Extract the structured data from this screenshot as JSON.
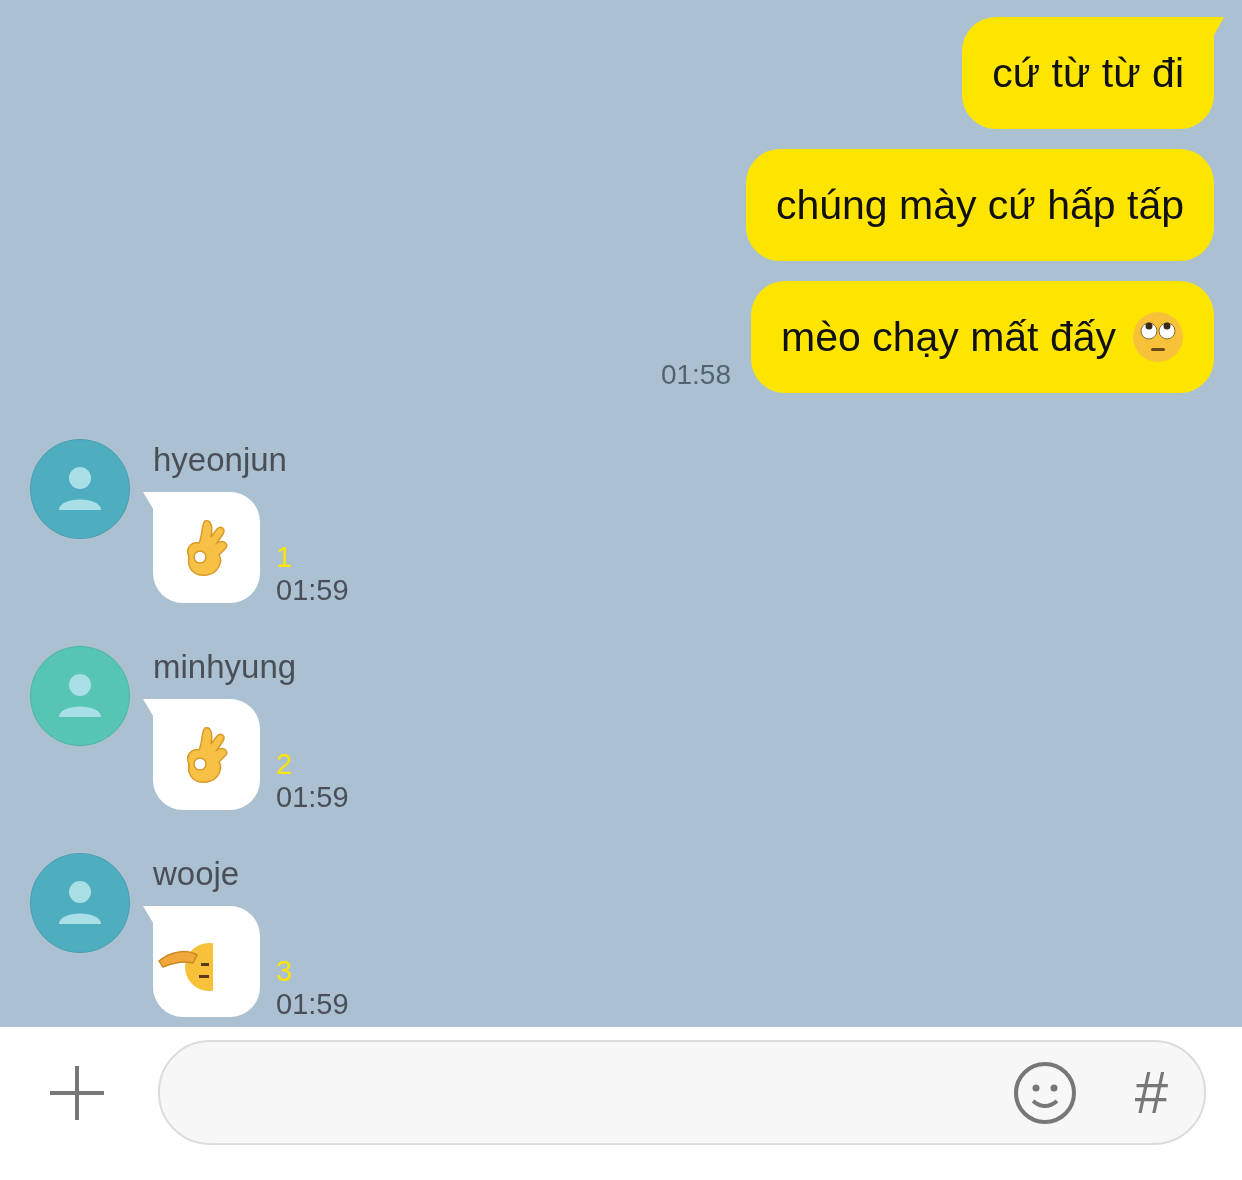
{
  "outgoing": [
    {
      "kind": "text",
      "text": "cứ từ từ đi",
      "tail": true
    },
    {
      "kind": "text",
      "text": "chúng mày cứ hấp tấp",
      "tail": false
    },
    {
      "kind": "emoji",
      "text": "mèo chạy mất đấy",
      "tail": false,
      "time": "01:58"
    }
  ],
  "incoming": [
    {
      "sender": "hyeonjun",
      "color": "#4fadc0",
      "kind": "hand",
      "unread": "1",
      "time": "01:59"
    },
    {
      "sender": "minhyung",
      "color": "#56c5b4",
      "kind": "hand",
      "unread": "2",
      "time": "01:59"
    },
    {
      "sender": "wooje",
      "color": "#4fadc0",
      "kind": "salute",
      "unread": "3",
      "time": "01:59"
    }
  ],
  "composer": {
    "hash": "#"
  }
}
